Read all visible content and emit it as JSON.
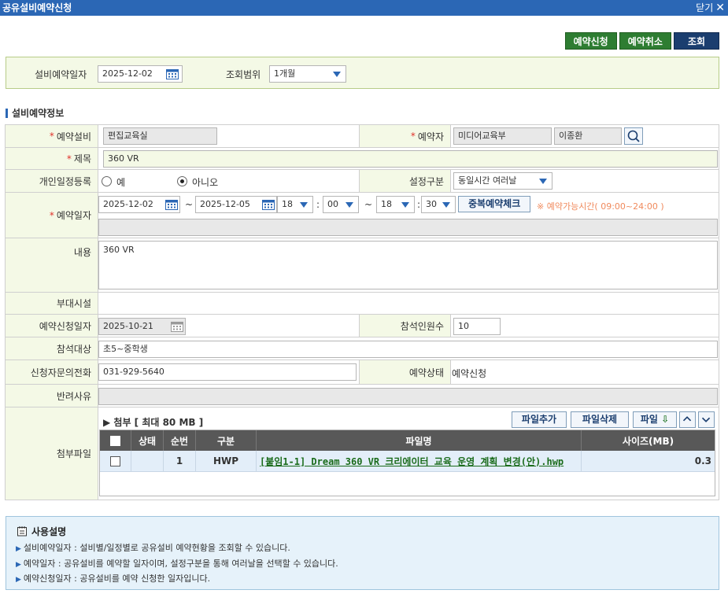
{
  "window": {
    "title": "공유설비예약신청",
    "close_label": "닫기"
  },
  "toolbar": {
    "apply": "예약신청",
    "cancel": "예약취소",
    "search": "조회"
  },
  "search": {
    "date_label": "설비예약일자",
    "date_value": "2025-12-02",
    "range_label": "조회범위",
    "range_value": "1개월"
  },
  "section_title": "설비예약정보",
  "form": {
    "facility": {
      "label": "예약설비",
      "value": "편집교육실"
    },
    "reserver": {
      "label": "예약자",
      "dept": "미디어교육부",
      "name": "이종환"
    },
    "subject": {
      "label": "제목",
      "value": "360 VR"
    },
    "personal": {
      "label": "개인일정등록",
      "opt_yes": "예",
      "opt_no": "아니오",
      "selected": "아니오"
    },
    "setting": {
      "label": "설정구분",
      "value": "동일시간 여러날"
    },
    "period": {
      "label": "예약일자",
      "start": "2025-12-02",
      "end": "2025-12-05",
      "tilde": "~",
      "start_hour": "18",
      "start_min": "00",
      "end_hour": "18",
      "end_min": "30",
      "colon": ":",
      "dup_check": "중복예약체크",
      "note": "※ 예약가능시간( 09:00~24:00 )"
    },
    "content": {
      "label": "내용",
      "value": "360 VR"
    },
    "facilities": {
      "label": "부대시설"
    },
    "apply_date": {
      "label": "예약신청일자",
      "value": "2025-10-21"
    },
    "attendees_count": {
      "label": "참석인원수",
      "value": "10"
    },
    "attendees_target": {
      "label": "참석대상",
      "value": "초5~중학생"
    },
    "phone": {
      "label": "신청자문의전화",
      "value": "031-929-5640"
    },
    "status": {
      "label": "예약상태",
      "value": "예약신청"
    },
    "reject": {
      "label": "반려사유"
    },
    "attach": {
      "label": "첨부파일",
      "caption": "▶ 첨부 [ 최대 80 MB ]",
      "add": "파일추가",
      "delete": "파일삭제",
      "download": "파일",
      "headers": {
        "state": "상태",
        "seq": "순번",
        "type": "구분",
        "name": "파일명",
        "size": "사이즈(MB)"
      },
      "files": [
        {
          "seq": "1",
          "type": "HWP",
          "name": "[붙임1-1] Dream 360 VR 크리에이터 교육 운영 계획 변경(안).hwp",
          "size": "0.3"
        }
      ]
    }
  },
  "guide": {
    "title": "사용설명",
    "items": [
      "설비예약일자 : 설비별/일정별로 공유설비 예약현황을 조회할 수 있습니다.",
      "예약일자 : 공유설비를 예약할 일자이며, 설정구분을 통해 여러날을 선택할 수 있습니다.",
      "예약신청일자 : 공유설비를 예약 신청한 일자입니다."
    ]
  },
  "colors": {
    "titlebar": "#2b67b5",
    "green_button": "#2e7d32",
    "navy_button": "#1b3e6f",
    "label_bg": "#f4f9e6",
    "required": "#e0322b"
  }
}
